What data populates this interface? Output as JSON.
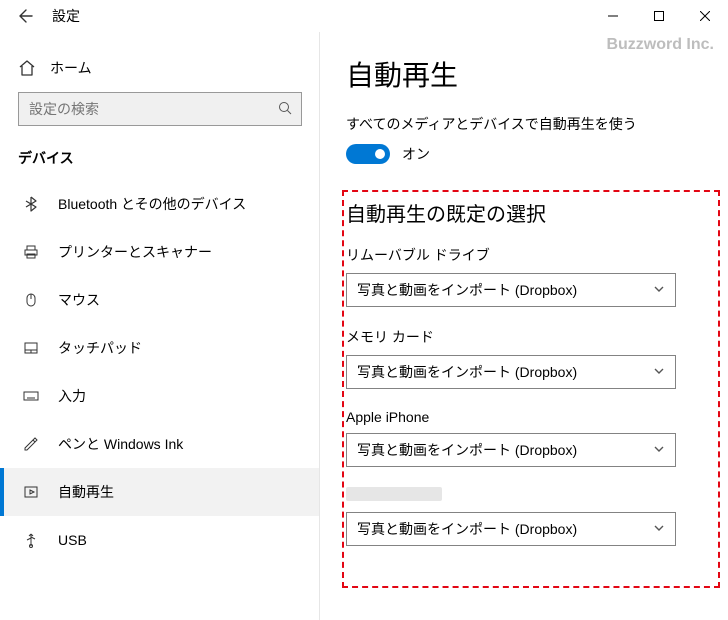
{
  "window": {
    "title": "設定",
    "watermark": "Buzzword Inc."
  },
  "sidebar": {
    "home": "ホーム",
    "search_placeholder": "設定の検索",
    "section": "デバイス",
    "items": [
      {
        "icon": "bluetooth",
        "label": "Bluetooth とその他のデバイス",
        "selected": false
      },
      {
        "icon": "printer",
        "label": "プリンターとスキャナー",
        "selected": false
      },
      {
        "icon": "mouse",
        "label": "マウス",
        "selected": false
      },
      {
        "icon": "touchpad",
        "label": "タッチパッド",
        "selected": false
      },
      {
        "icon": "keyboard",
        "label": "入力",
        "selected": false
      },
      {
        "icon": "pen",
        "label": "ペンと Windows Ink",
        "selected": false
      },
      {
        "icon": "autoplay",
        "label": "自動再生",
        "selected": true
      },
      {
        "icon": "usb",
        "label": "USB",
        "selected": false
      }
    ]
  },
  "main": {
    "title": "自動再生",
    "toggle_desc": "すべてのメディアとデバイスで自動再生を使う",
    "toggle_state": "オン",
    "defaults_title": "自動再生の既定の選択",
    "fields": [
      {
        "label": "リムーバブル ドライブ",
        "value": "写真と動画をインポート (Dropbox)"
      },
      {
        "label": "メモリ カード",
        "value": "写真と動画をインポート (Dropbox)"
      },
      {
        "label": "Apple iPhone",
        "value": "写真と動画をインポート (Dropbox)"
      },
      {
        "label": "",
        "value": "写真と動画をインポート (Dropbox)",
        "blurred": true
      }
    ]
  }
}
